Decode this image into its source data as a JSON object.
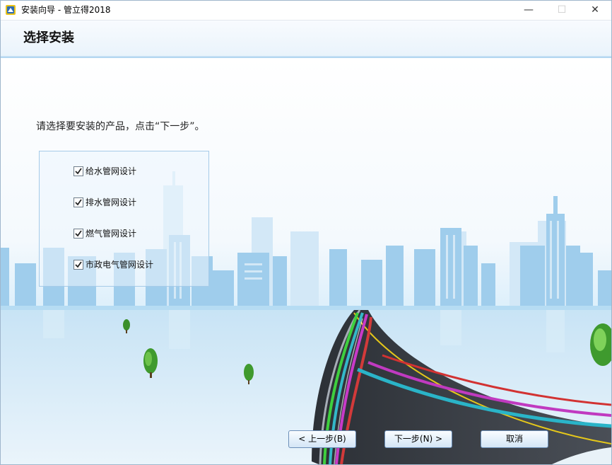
{
  "window": {
    "title": "安装向导 - 管立得2018",
    "minimize_glyph": "—",
    "maximize_glyph": "☐",
    "close_glyph": "✕"
  },
  "header": {
    "title": "选择安装"
  },
  "instruction": "请选择要安装的产品，点击“下一步”。",
  "products": [
    {
      "label": "给水管网设计",
      "checked": true
    },
    {
      "label": "排水管网设计",
      "checked": true
    },
    {
      "label": "燃气管网设计",
      "checked": true
    },
    {
      "label": "市政电气管网设计",
      "checked": true
    }
  ],
  "buttons": {
    "back": "< 上一步(B)",
    "next": "下一步(N) >",
    "cancel": "取消"
  },
  "colors": {
    "sky_top": "#ffffff",
    "sky_bottom": "#cfe6f6",
    "city": "#9fcdec",
    "road": "#3a3e44",
    "accent_border": "#6c8fb8"
  }
}
